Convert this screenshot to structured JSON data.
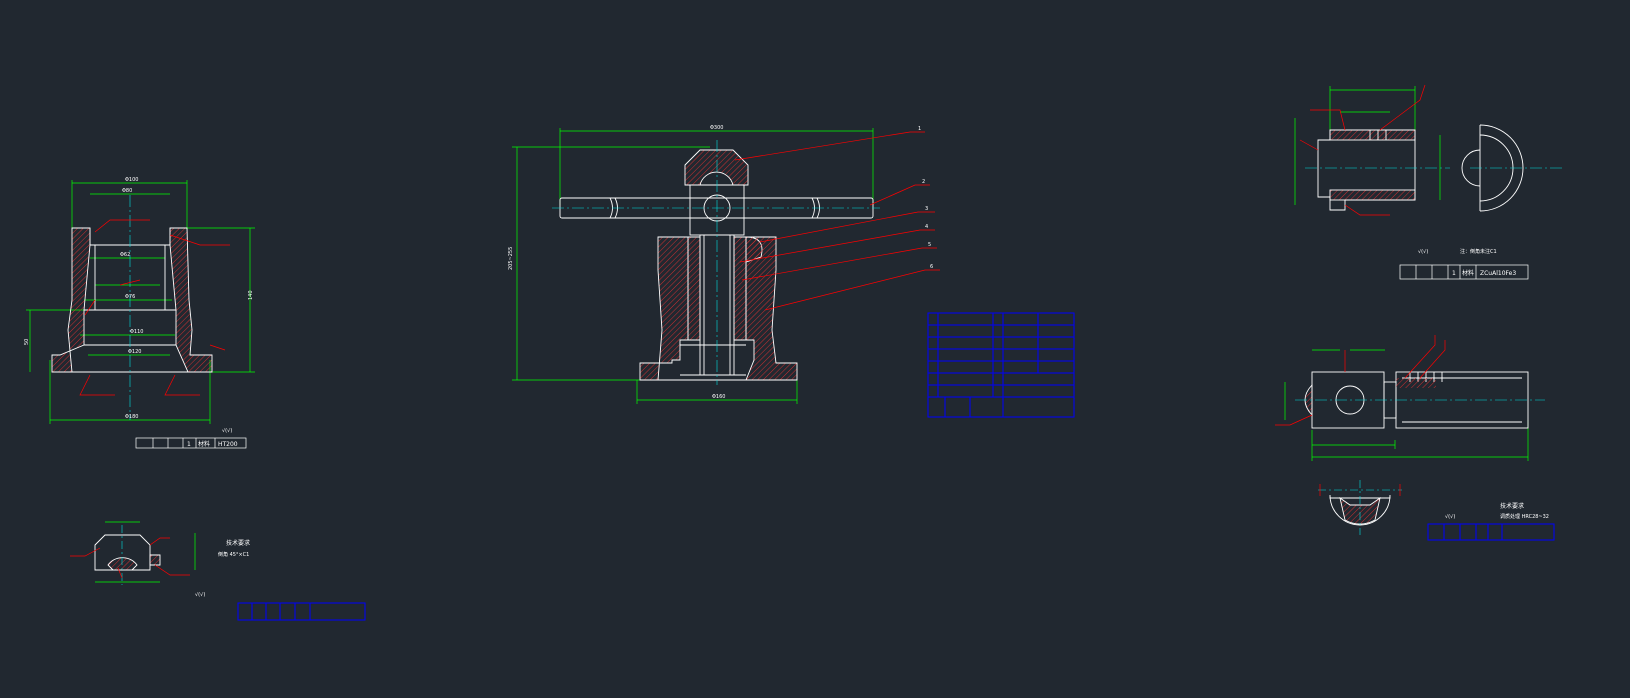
{
  "colors": {
    "background": "#212830",
    "outline": "#ffffff",
    "dimension": "#00ff00",
    "leader": "#ff0000",
    "centerline": "#00e0e0",
    "table": "#0000ff"
  },
  "base_part": {
    "material_label": "材料",
    "material": "HT200",
    "quantity": "1",
    "roughness": "√(√)"
  },
  "nut_part": {
    "material": "ZCuAl10Fe3",
    "quantity": "1",
    "note": "注：倒角未注C1",
    "material_label": "材料",
    "roughness": "√(√)"
  },
  "small_cap_part": {
    "title": "技术要求",
    "note": "倒角 45°×C1",
    "roughness": "√(√)"
  },
  "screw_part": {
    "title": "技术要求",
    "note": "调质处理 HRC28~32",
    "roughness": "√(√)"
  },
  "assembly": {
    "balloons": [
      "1",
      "2",
      "3",
      "4",
      "5",
      "6"
    ]
  }
}
